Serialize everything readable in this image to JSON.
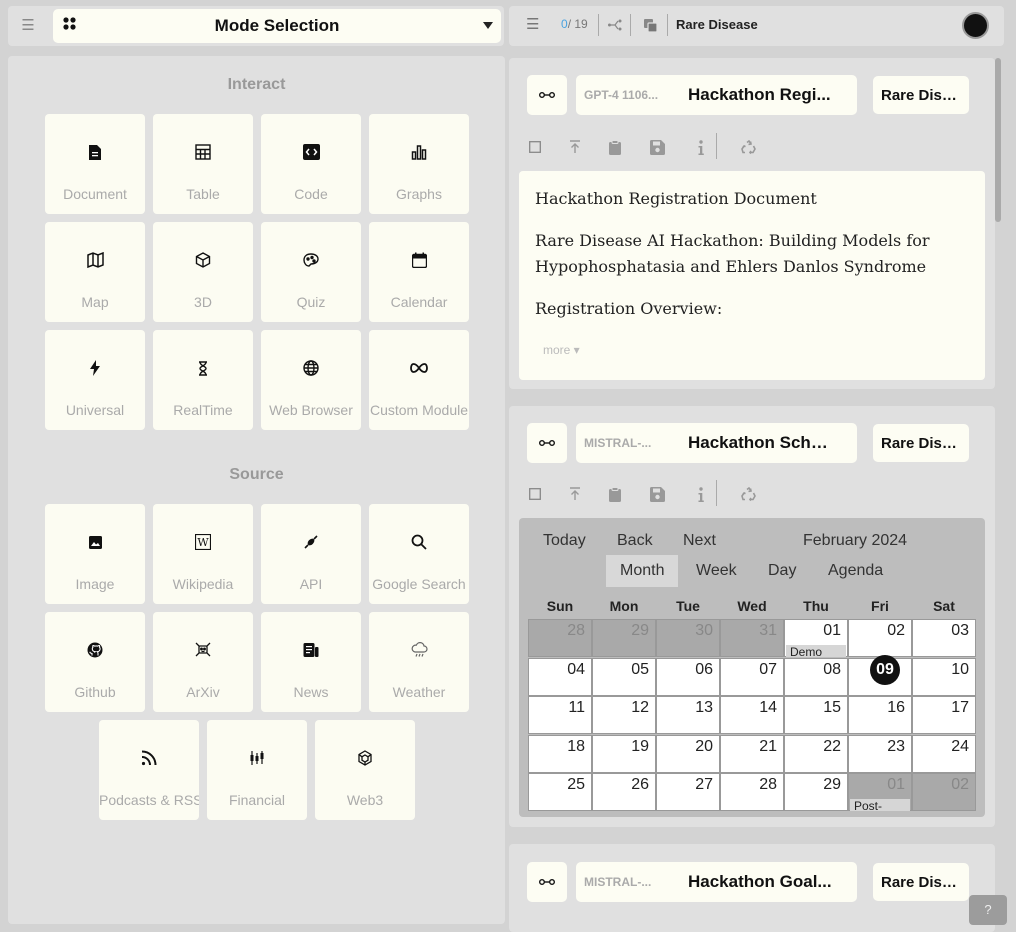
{
  "left_panel": {
    "mode_title": "Mode Selection",
    "interact_title": "Interact",
    "interact_tiles": [
      {
        "label": "Document",
        "icon": "document-icon"
      },
      {
        "label": "Table",
        "icon": "table-icon"
      },
      {
        "label": "Code",
        "icon": "code-icon"
      },
      {
        "label": "Graphs",
        "icon": "graphs-icon"
      },
      {
        "label": "Map",
        "icon": "map-icon"
      },
      {
        "label": "3D",
        "icon": "cube-icon"
      },
      {
        "label": "Quiz",
        "icon": "quiz-icon"
      },
      {
        "label": "Calendar",
        "icon": "calendar-icon"
      },
      {
        "label": "Universal",
        "icon": "lightning-icon"
      },
      {
        "label": "RealTime",
        "icon": "hourglass-icon"
      },
      {
        "label": "Web Browser",
        "icon": "globe-icon"
      },
      {
        "label": "Custom Module",
        "icon": "infinity-icon"
      }
    ],
    "source_title": "Source",
    "source_tiles": [
      {
        "label": "Image",
        "icon": "image-icon"
      },
      {
        "label": "Wikipedia",
        "icon": "wikipedia-icon"
      },
      {
        "label": "API",
        "icon": "api-icon"
      },
      {
        "label": "Google Search",
        "icon": "search-icon"
      },
      {
        "label": "Github",
        "icon": "github-icon"
      },
      {
        "label": "ArXiv",
        "icon": "arxiv-icon"
      },
      {
        "label": "News",
        "icon": "news-icon"
      },
      {
        "label": "Weather",
        "icon": "weather-icon"
      },
      {
        "label": "Podcasts & RSS",
        "icon": "rss-icon"
      },
      {
        "label": "Financial",
        "icon": "candlestick-icon"
      },
      {
        "label": "Web3",
        "icon": "web3-icon"
      }
    ]
  },
  "right_bar": {
    "counter_current": "0",
    "counter_total": "/ 19",
    "title": "Rare Disease"
  },
  "cards": [
    {
      "model": "GPT-4 1106...",
      "title": "Hackathon Regi...",
      "tag": "Rare Dise...",
      "content": [
        "Hackathon Registration Document",
        "Rare Disease AI Hackathon: Building Models for Hypophosphatasia and Ehlers Danlos Syndrome",
        "Registration Overview:"
      ],
      "more": "more ▾"
    },
    {
      "model": "MISTRAL-...",
      "title": "Hackathon Sche...",
      "tag": "Rare Dise...",
      "calendar": {
        "nav": [
          "Today",
          "Back",
          "Next"
        ],
        "month_label": "February 2024",
        "views": [
          "Month",
          "Week",
          "Day",
          "Agenda"
        ],
        "active_view": "Month",
        "weekdays": [
          "Sun",
          "Mon",
          "Tue",
          "Wed",
          "Thu",
          "Fri",
          "Sat"
        ],
        "weeks": [
          [
            "28",
            "29",
            "30",
            "31",
            "01",
            "02",
            "03"
          ],
          [
            "04",
            "05",
            "06",
            "07",
            "08",
            "09",
            "10"
          ],
          [
            "11",
            "12",
            "13",
            "14",
            "15",
            "16",
            "17"
          ],
          [
            "18",
            "19",
            "20",
            "21",
            "22",
            "23",
            "24"
          ],
          [
            "25",
            "26",
            "27",
            "28",
            "29",
            "01",
            "02"
          ]
        ],
        "events": [
          "Demo",
          "Post-"
        ],
        "today": "09"
      }
    },
    {
      "model": "MISTRAL-...",
      "title": "Hackathon Goal...",
      "tag": "Rare Dise..."
    }
  ],
  "help": "?"
}
